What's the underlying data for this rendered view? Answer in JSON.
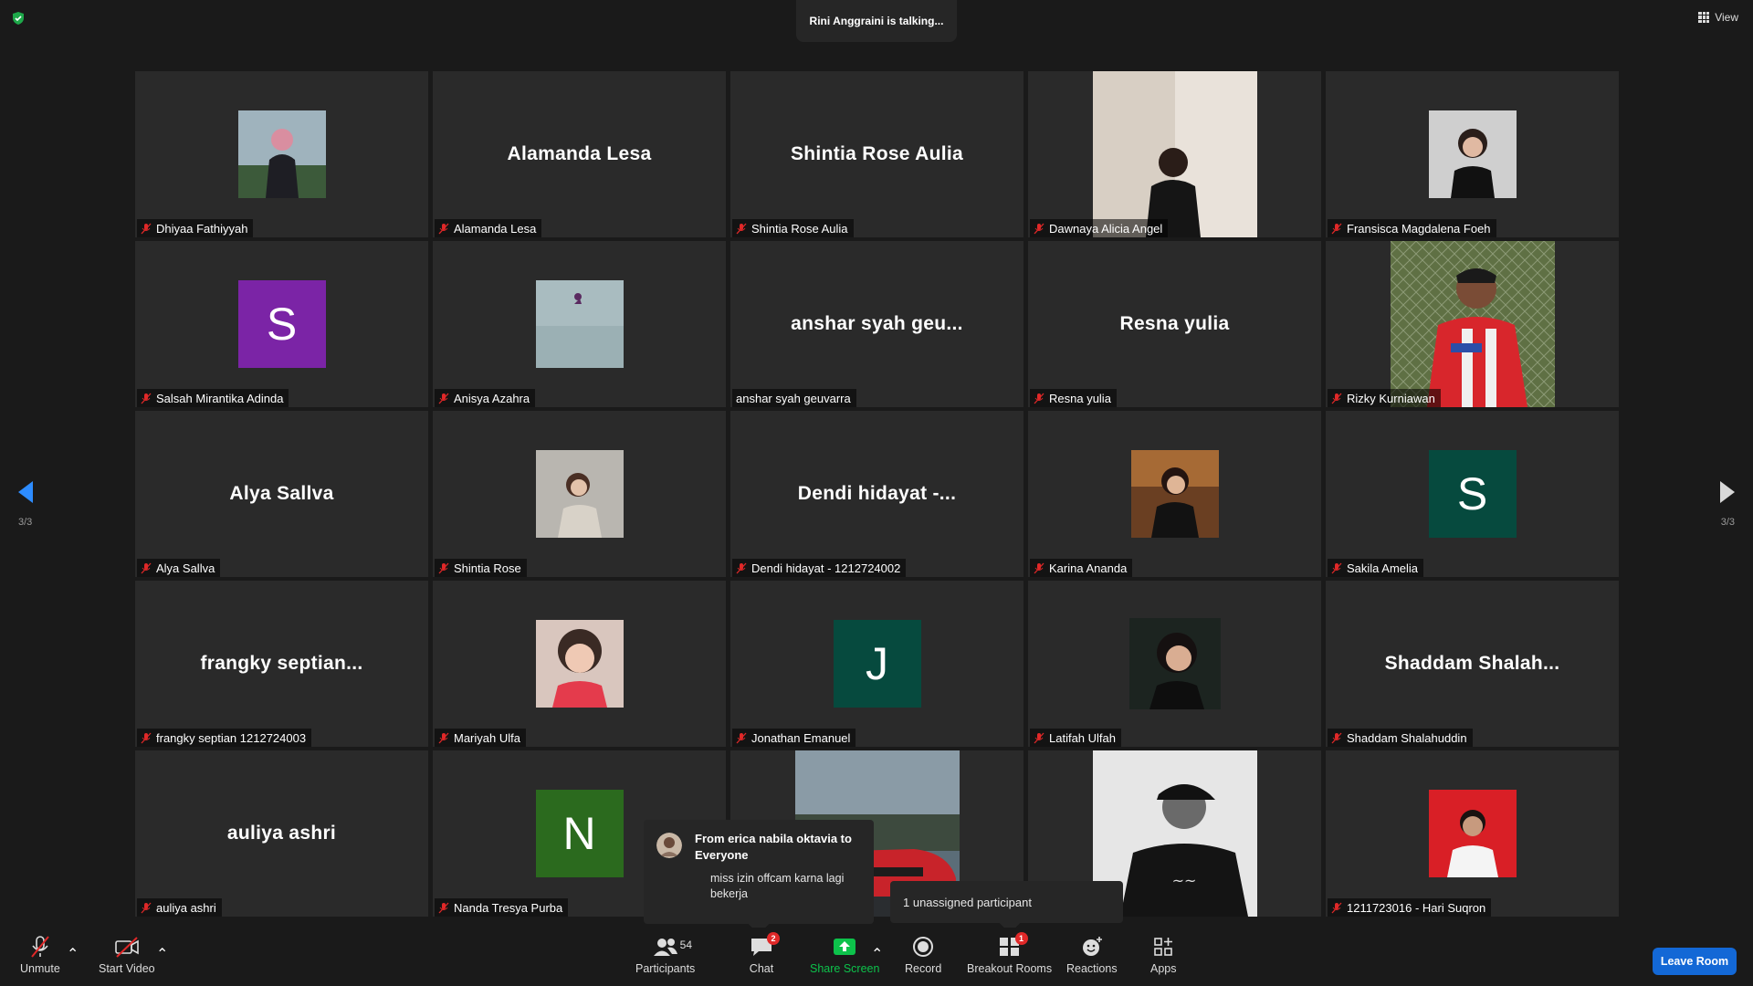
{
  "talking": "Rini Anggraini is talking...",
  "view_label": "View",
  "pagination": {
    "left": "3/3",
    "right": "3/3"
  },
  "tiles": [
    {
      "label": "Dhiyaa Fathiyyah",
      "muted": true
    },
    {
      "label": "Alamanda Lesa",
      "big": "Alamanda Lesa",
      "muted": true
    },
    {
      "label": "Shintia Rose Aulia",
      "big": "Shintia Rose Aulia",
      "muted": true
    },
    {
      "label": "Dawnaya Alicia Angel",
      "muted": true
    },
    {
      "label": "Fransisca Magdalena Foeh",
      "muted": true
    },
    {
      "label": "Salsah Mirantika Adinda",
      "initial": "S",
      "color": "#7b24a6",
      "muted": true
    },
    {
      "label": "Anisya Azahra",
      "muted": true
    },
    {
      "label": "anshar syah geuvarra",
      "big": "anshar syah geu...",
      "muted": false
    },
    {
      "label": "Resna yulia",
      "big": "Resna yulia",
      "muted": true
    },
    {
      "label": "Rizky Kurniawan",
      "muted": true
    },
    {
      "label": "Alya Sallva",
      "big": "Alya Sallva",
      "muted": true
    },
    {
      "label": "Shintia Rose",
      "muted": true
    },
    {
      "label": "Dendi hidayat - 1212724002",
      "big": "Dendi hidayat -...",
      "muted": true
    },
    {
      "label": "Karina Ananda",
      "muted": true
    },
    {
      "label": "Sakila Amelia",
      "initial": "S",
      "color": "#064a3e",
      "muted": true
    },
    {
      "label": "frangky septian 1212724003",
      "big": "frangky septian...",
      "muted": true
    },
    {
      "label": "Mariyah Ulfa",
      "muted": true
    },
    {
      "label": "Jonathan Emanuel",
      "initial": "J",
      "color": "#064a3e",
      "muted": true
    },
    {
      "label": "Latifah Ulfah",
      "muted": true
    },
    {
      "label": "Shaddam Shalahuddin",
      "big": "Shaddam Shalah...",
      "muted": true
    },
    {
      "label": "auliya ashri",
      "big": "auliya ashri",
      "muted": true
    },
    {
      "label": "Nanda Tresya Purba",
      "initial": "N",
      "color": "#2b6a1e",
      "muted": true
    },
    {
      "label": "",
      "muted": false
    },
    {
      "label": "",
      "muted": false
    },
    {
      "label": "1211723016 - Hari Suqron",
      "muted": true
    }
  ],
  "chat_popup": {
    "from": "From erica nabila oktavia to Everyone",
    "message": "miss izin offcam karna lagi bekerja"
  },
  "unassigned_popup": "1 unassigned participant",
  "toolbar": {
    "unmute": "Unmute",
    "start_video": "Start Video",
    "participants": "Participants",
    "participants_count": "54",
    "chat": "Chat",
    "chat_badge": "2",
    "share_screen": "Share Screen",
    "record": "Record",
    "breakout_rooms": "Breakout Rooms",
    "breakout_badge": "1",
    "reactions": "Reactions",
    "apps": "Apps",
    "leave_room": "Leave Room"
  },
  "colors": {
    "share_green": "#0dc24b",
    "leave_blue": "#1368d6",
    "muted_red": "#e02828",
    "nav_blue": "#2d8cff"
  }
}
